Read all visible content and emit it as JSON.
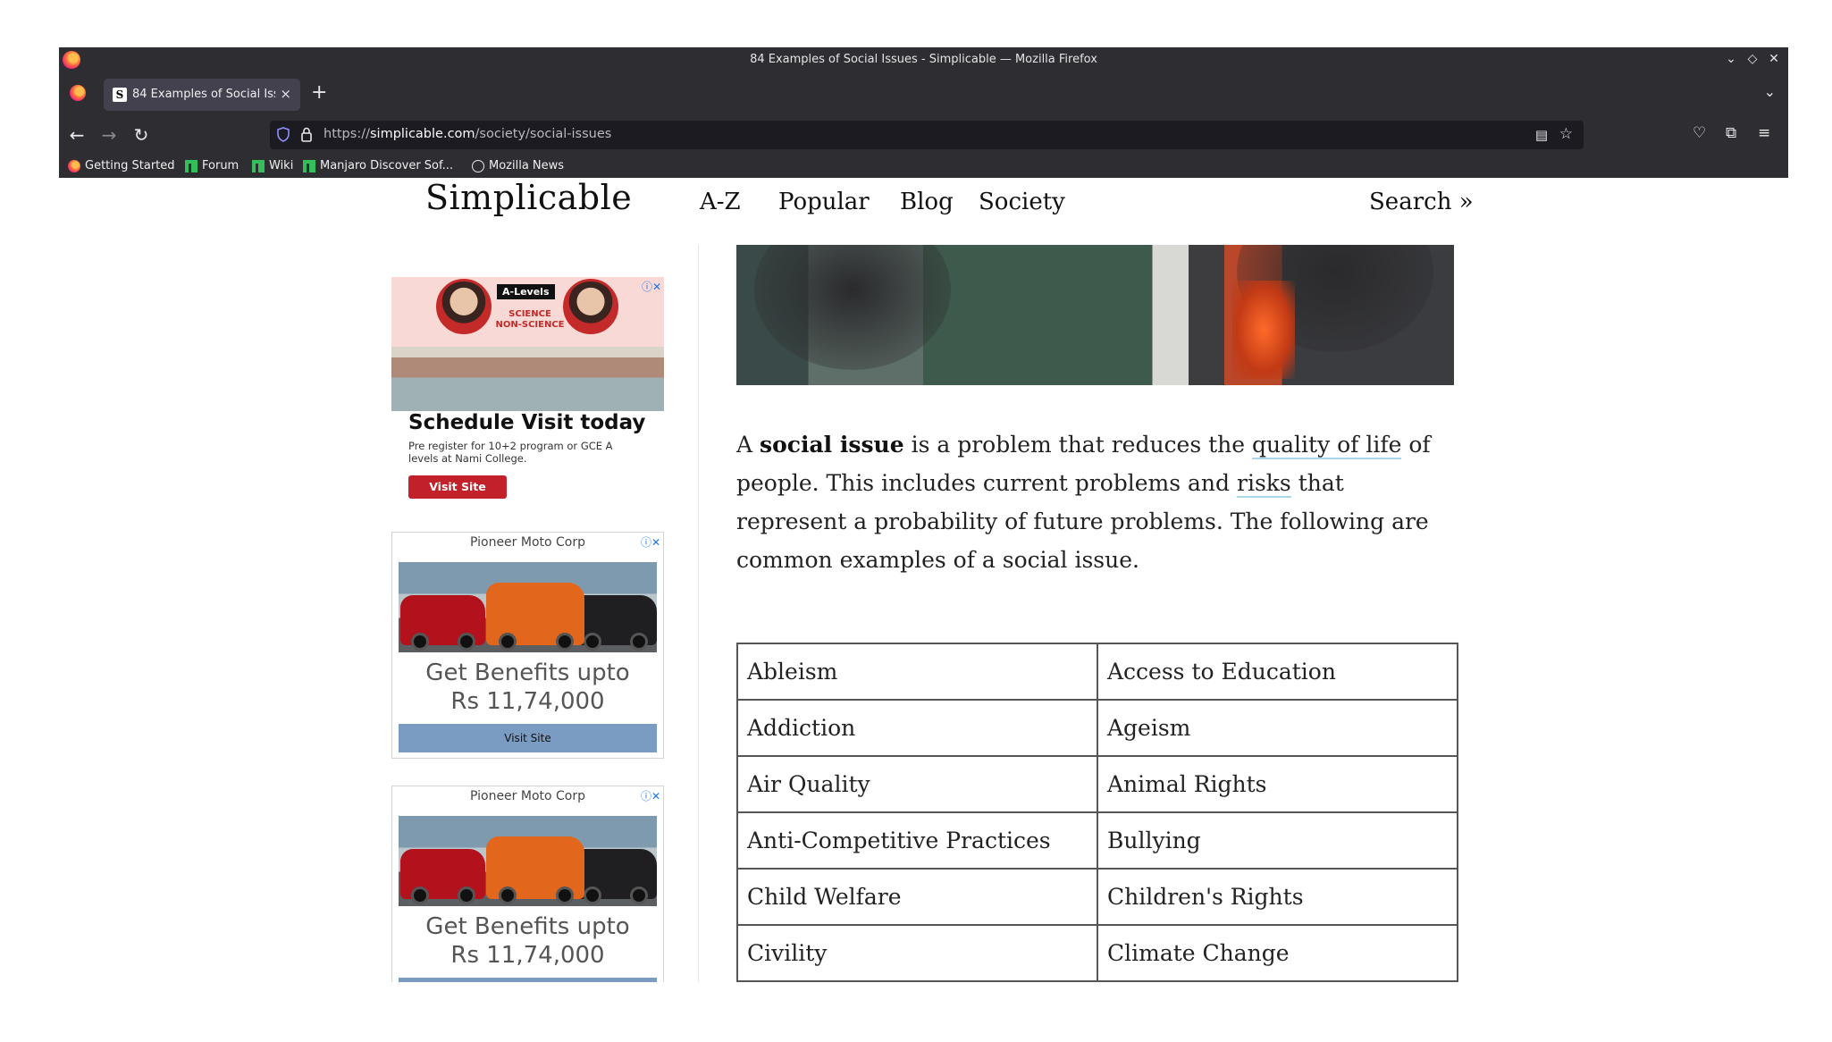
{
  "window": {
    "title": "84 Examples of Social Issues - Simplicable — Mozilla Firefox"
  },
  "tab": {
    "label": "84 Examples of Social Issues",
    "favicon": "S"
  },
  "urlbar": {
    "prefix": "https://",
    "domain": "simplicable.com",
    "path": "/society/social-issues"
  },
  "bookmarks": [
    {
      "label": "Getting Started",
      "icon": "firefox-icon"
    },
    {
      "label": "Forum",
      "icon": "manjaro-icon"
    },
    {
      "label": "Wiki",
      "icon": "manjaro-icon"
    },
    {
      "label": "Manjaro Discover Sof...",
      "icon": "manjaro-icon"
    },
    {
      "label": "Mozilla News",
      "icon": "globe-icon"
    }
  ],
  "site": {
    "logo": "Simplicable",
    "nav": [
      "A-Z",
      "Popular",
      "Blog",
      "Society"
    ],
    "search": "Search »"
  },
  "ads": {
    "college": {
      "badge": "A-Levels",
      "science": "SCIENCE",
      "nonscience": "NON-SCIENCE",
      "headline": "Schedule Visit today",
      "sub": "Pre register for 10+2 program or GCE A levels at Nami College.",
      "cta": "Visit Site"
    },
    "moto1": {
      "sponsor": "Pioneer Moto Corp",
      "headline1": "Get Benefits upto",
      "headline2": "Rs 11,74,000",
      "cta": "Visit Site"
    },
    "moto2": {
      "sponsor": "Pioneer Moto Corp",
      "headline1": "Get Benefits upto",
      "headline2": "Rs 11,74,000"
    }
  },
  "article": {
    "p1_a": "A ",
    "p1_term": "social issue",
    "p1_b": " is a problem that reduces the ",
    "p1_link1": "quality of life",
    "p1_c": " of people. This includes current problems and ",
    "p1_link2": "risks",
    "p1_d": " that represent a probability of future problems. The following are common examples of a social issue."
  },
  "table": [
    [
      "Ableism",
      "Access to Education"
    ],
    [
      "Addiction",
      "Ageism"
    ],
    [
      "Air Quality",
      "Animal Rights"
    ],
    [
      "Anti-Competitive Practices",
      "Bullying"
    ],
    [
      "Child Welfare",
      "Children's Rights"
    ],
    [
      "Civility",
      "Climate Change"
    ],
    [
      "",
      ""
    ]
  ],
  "colors": {
    "chrome": "#2e2e32",
    "urlbar": "#1c1b22",
    "link_underline": "#a8d8ea",
    "ad_cta_red": "#c3212a",
    "ad_cta_blue": "#7a9bc2"
  }
}
